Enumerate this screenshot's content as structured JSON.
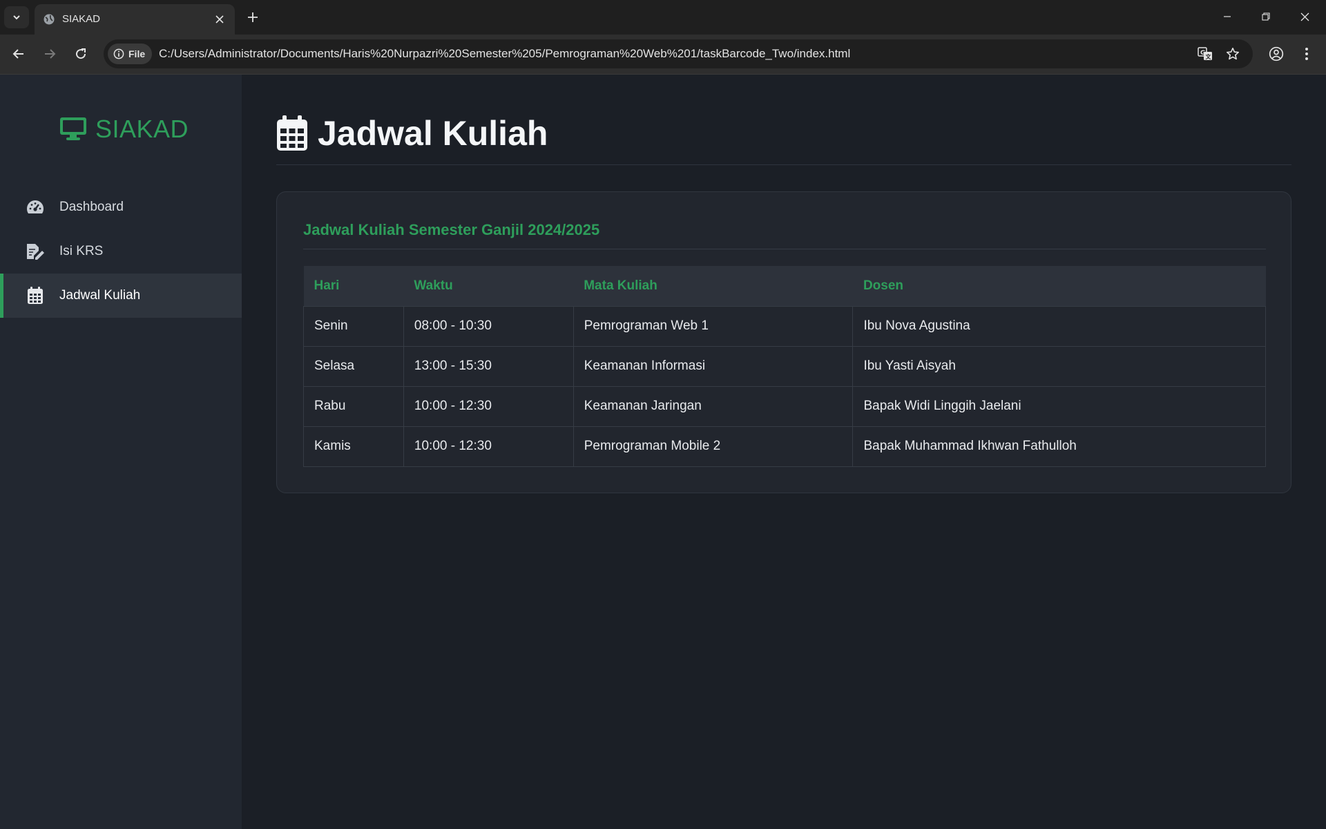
{
  "browser": {
    "tab_title": "SIAKAD",
    "file_chip": "File",
    "url": "C:/Users/Administrator/Documents/Haris%20Nurpazri%20Semester%205/Pemrograman%20Web%201/taskBarcode_Two/index.html"
  },
  "sidebar": {
    "brand": "SIAKAD",
    "items": [
      {
        "label": "Dashboard",
        "icon": "gauge-icon",
        "active": false
      },
      {
        "label": "Isi KRS",
        "icon": "edit-document-icon",
        "active": false
      },
      {
        "label": "Jadwal Kuliah",
        "icon": "calendar-icon",
        "active": true
      }
    ]
  },
  "main": {
    "title": "Jadwal Kuliah",
    "card_title": "Jadwal Kuliah Semester Ganjil 2024/2025",
    "table": {
      "headers": [
        "Hari",
        "Waktu",
        "Mata Kuliah",
        "Dosen"
      ],
      "rows": [
        [
          "Senin",
          "08:00 - 10:30",
          "Pemrograman Web 1",
          "Ibu Nova Agustina"
        ],
        [
          "Selasa",
          "13:00 - 15:30",
          "Keamanan Informasi",
          "Ibu Yasti Aisyah"
        ],
        [
          "Rabu",
          "10:00 - 12:30",
          "Keamanan Jaringan",
          "Bapak Widi Linggih Jaelani"
        ],
        [
          "Kamis",
          "10:00 - 12:30",
          "Pemrograman Mobile 2",
          "Bapak Muhammad Ikhwan Fathulloh"
        ]
      ]
    }
  },
  "colors": {
    "accent": "#2e9e5b",
    "background": "#1b1f26",
    "sidebar": "#222730"
  }
}
